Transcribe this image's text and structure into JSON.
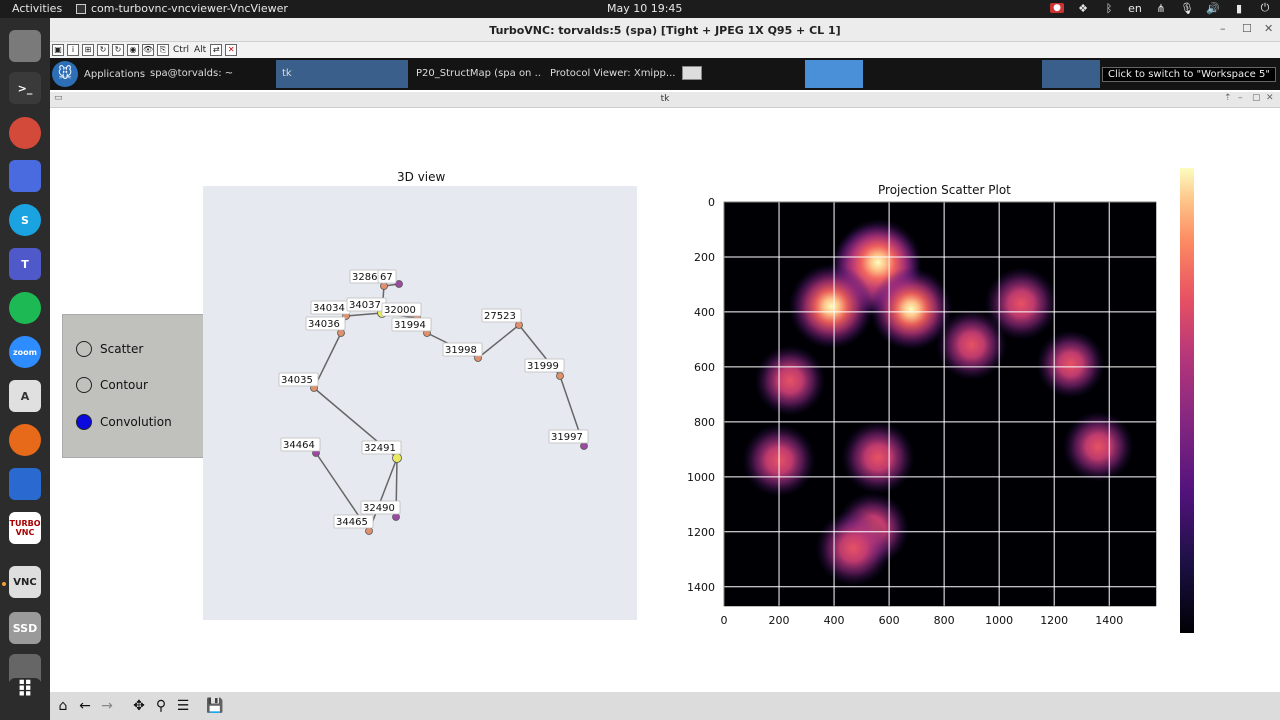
{
  "topbar": {
    "activities": "Activities",
    "app_name": "com-turbovnc-vncviewer-VncViewer",
    "clock": "May 10  19:45",
    "lang": "en"
  },
  "dock": {
    "items": [
      {
        "icon": "files-icon",
        "color": "#7a7a7a",
        "label": ""
      },
      {
        "icon": "terminal-icon",
        "color": "#3a3a3a",
        "label": ">_"
      },
      {
        "icon": "chrome-icon",
        "color": "#d44a3a",
        "label": ""
      },
      {
        "icon": "screenshot-icon",
        "color": "#4a6be0",
        "label": ""
      },
      {
        "icon": "skype-icon",
        "color": "#1aa3e0",
        "label": "S"
      },
      {
        "icon": "teams-icon",
        "color": "#5059c9",
        "label": "T"
      },
      {
        "icon": "spotify-icon",
        "color": "#1db954",
        "label": ""
      },
      {
        "icon": "zoom-icon",
        "color": "#2d8cff",
        "label": "zoom"
      },
      {
        "icon": "software-center-icon",
        "color": "#e0e0e0",
        "label": "A"
      },
      {
        "icon": "firefox-icon",
        "color": "#e66a1a",
        "label": ""
      },
      {
        "icon": "writer-icon",
        "color": "#2a6ad0",
        "label": ""
      },
      {
        "icon": "turbovnc-icon",
        "color": "#ffffff",
        "label": "TURBO VNC"
      },
      {
        "icon": "vncviewer-icon",
        "color": "#dedede",
        "label": "VNC"
      },
      {
        "icon": "ssd-icon",
        "color": "#9a9a9a",
        "label": "SSD"
      },
      {
        "icon": "drive-icon",
        "color": "#666666",
        "label": ""
      },
      {
        "icon": "app-grid-icon",
        "color": "#2c2c2c",
        "label": "⠿"
      }
    ]
  },
  "vnc": {
    "title": "TurboVNC: torvalds:5 (spa) [Tight + JPEG 1X Q95 + CL 1]",
    "toolbar_text": [
      "Ctrl",
      "Alt"
    ]
  },
  "panel": {
    "applications": "Applications",
    "tasks": [
      {
        "label": "spa@torvalds: ~",
        "active": false
      },
      {
        "label": "tk",
        "active": true
      },
      {
        "label": "P20_StructMap (spa on ...",
        "active": false
      },
      {
        "label": "Protocol Viewer: Xmipp...",
        "active": false
      }
    ],
    "tooltip": "Click to switch to \"Workspace 5\""
  },
  "tk": {
    "title": "tk",
    "radio": {
      "options": [
        {
          "label": "Scatter",
          "selected": false
        },
        {
          "label": "Contour",
          "selected": false
        },
        {
          "label": "Convolution",
          "selected": true
        }
      ]
    }
  },
  "view3d": {
    "title": "3D view",
    "bg": "#e6e9ef",
    "nodes": [
      {
        "id": "32866",
        "color": "#e0906a"
      },
      {
        "id": "67",
        "color": "#9b4aa0"
      },
      {
        "id": "34034",
        "color": "#e0906a"
      },
      {
        "id": "34037",
        "color": "#eaea60"
      },
      {
        "id": "32000",
        "color": "#e0906a"
      },
      {
        "id": "34036",
        "color": "#e0906a"
      },
      {
        "id": "31994",
        "color": "#e0906a"
      },
      {
        "id": "27523",
        "color": "#e0906a"
      },
      {
        "id": "31998",
        "color": "#e0906a"
      },
      {
        "id": "31999",
        "color": "#e0906a"
      },
      {
        "id": "34035",
        "color": "#e0906a"
      },
      {
        "id": "31997",
        "color": "#9b4aa0"
      },
      {
        "id": "34464",
        "color": "#9b4aa0"
      },
      {
        "id": "32491",
        "color": "#eaea60"
      },
      {
        "id": "32490",
        "color": "#9b4aa0"
      },
      {
        "id": "34465",
        "color": "#e0906a"
      }
    ]
  },
  "chart_data": {
    "type": "heatmap",
    "title": "Projection Scatter Plot",
    "x_ticks": [
      "0",
      "200",
      "400",
      "600",
      "800",
      "1000",
      "1200",
      "1400"
    ],
    "y_ticks": [
      "0",
      "200",
      "400",
      "600",
      "800",
      "1000",
      "1200",
      "1400"
    ],
    "xlim": [
      0,
      1570
    ],
    "ylim": [
      1470,
      0
    ],
    "grid": true,
    "colormap": "magma",
    "blobs": [
      {
        "x": 550,
        "y": 250,
        "intensity": 1.0
      },
      {
        "x": 560,
        "y": 220,
        "intensity": 0.9
      },
      {
        "x": 390,
        "y": 380,
        "intensity": 0.85
      },
      {
        "x": 680,
        "y": 390,
        "intensity": 0.8
      },
      {
        "x": 1080,
        "y": 370,
        "intensity": 0.6
      },
      {
        "x": 900,
        "y": 520,
        "intensity": 0.55
      },
      {
        "x": 1260,
        "y": 590,
        "intensity": 0.5
      },
      {
        "x": 240,
        "y": 650,
        "intensity": 0.55
      },
      {
        "x": 200,
        "y": 940,
        "intensity": 0.6
      },
      {
        "x": 560,
        "y": 930,
        "intensity": 0.6
      },
      {
        "x": 1360,
        "y": 890,
        "intensity": 0.55
      },
      {
        "x": 540,
        "y": 1190,
        "intensity": 0.6
      },
      {
        "x": 470,
        "y": 1260,
        "intensity": 0.65
      }
    ]
  }
}
